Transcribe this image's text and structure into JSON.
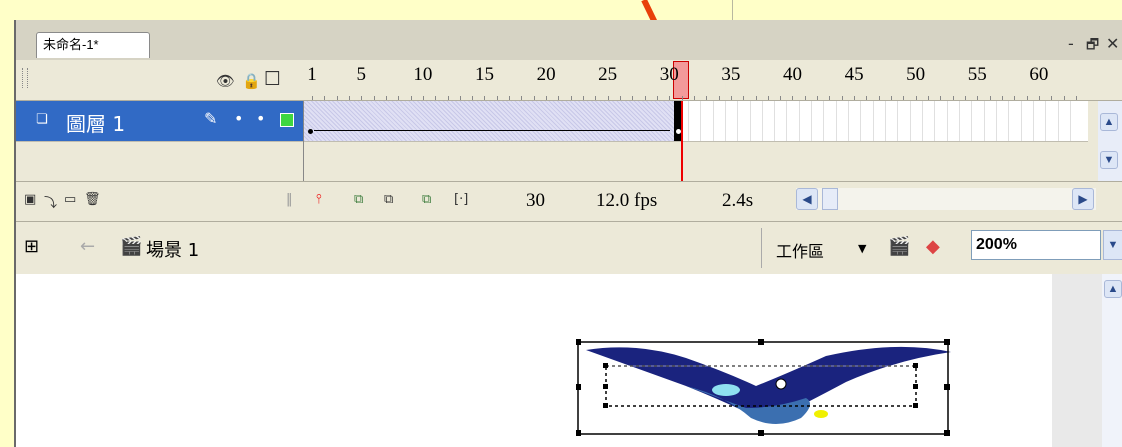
{
  "document_tab": {
    "title": "未命名-1*"
  },
  "window_controls": {
    "minimize": "-",
    "restore": "🗗",
    "close": "✕"
  },
  "timeline": {
    "header_icons": {
      "eye": "👁",
      "lock": "🔒",
      "outline": "☐"
    },
    "ruler_ticks": [
      "1",
      "5",
      "10",
      "15",
      "20",
      "25",
      "30",
      "35",
      "40",
      "45",
      "50",
      "55",
      "60"
    ],
    "current_frame_marker": "30",
    "layer": {
      "name": "圖層 1",
      "pencil": "✎",
      "dot1": "•",
      "dot2": "•"
    },
    "status": {
      "frame": "30",
      "fps": "12.0 fps",
      "time": "2.4s"
    }
  },
  "editbar": {
    "scene_label": "場景 1",
    "workspace_label": "工作區",
    "zoom_value": "200%"
  },
  "colors": {
    "selected_layer": "#316ac5",
    "playhead": "#e00000",
    "outline_box": "#3fd63f"
  }
}
